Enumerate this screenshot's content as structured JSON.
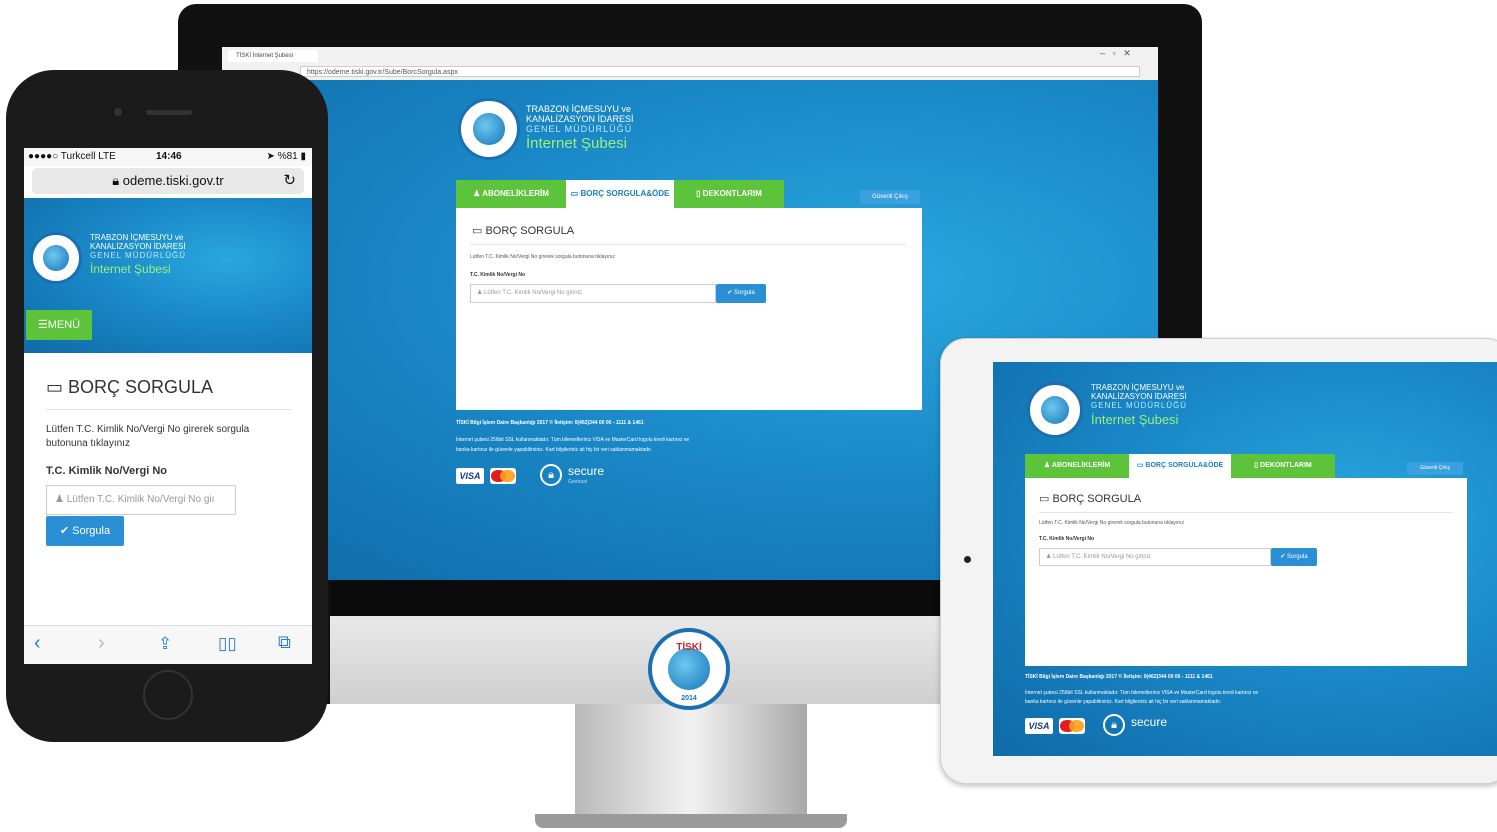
{
  "site": {
    "org_line1": "TRABZON İÇMESUYU ve",
    "org_line2": "KANALİZASYON İDARESİ",
    "org_line3": "GENEL MÜDÜRLÜĞÜ",
    "brand": "İnternet Şubesi",
    "emblem_text": "TİSKİ",
    "emblem_year": "2014"
  },
  "desktop": {
    "browser_tab": "TİSKİ İnternet Şubesi",
    "url": "https://odeme.tiski.gov.tr/Sube/BorcSorgula.aspx",
    "tabs": [
      "ABONELİKLERİM",
      "BORÇ SORGULA&ÖDE",
      "DEKONTLARIM"
    ],
    "logout": "Güvenli Çıkış",
    "panel_title": "BORÇ SORGULA",
    "instruction": "Lütfen T.C. Kimlik No/Vergi No girerek sorgula butonuna tıklayınız",
    "field_label": "T.C. Kimlik No/Vergi No",
    "field_placeholder": "Lütfen T.C. Kimlik No/Vergi No giriniz",
    "button": "Sorgula",
    "footer_line1": "TİSKİ Bilgi İşlem Daire Başkanlığı 2017 © İletişim: 0(462)344 00 00 - 1111 & 1461",
    "footer_line2": "İnternet şubesi 256bit SSL kullanmaktadır. Tüm bilemelleriniz VISA ve MasterCard logolu kredi kartınız ve",
    "footer_line3": "banka kartınız ile güvenle yapabilirsiniz. Kart bilgileriniz ait hiç bir veri saklanmamaktadır.",
    "visa": "VISA",
    "secure": "secure",
    "secure_sub": "Geotrust"
  },
  "phone": {
    "carrier": "●●●●○ Turkcell  LTE",
    "time": "14:46",
    "battery": "%81",
    "url": "odeme.tiski.gov.tr",
    "menu": "MENÜ",
    "panel_title": "BORÇ SORGULA",
    "instruction": "Lütfen T.C. Kimlik No/Vergi No girerek sorgula butonuna tıklayınız",
    "field_label": "T.C. Kimlik No/Vergi No",
    "field_placeholder": "Lütfen T.C. Kimlik No/Vergi No giı",
    "button": "Sorgula"
  },
  "tablet": {
    "tabs": [
      "ABONELİKLERİM",
      "BORÇ SORGULA&ÖDE",
      "DEKONTLARIM"
    ],
    "logout": "Güvenli Çıkış",
    "panel_title": "BORÇ SORGULA",
    "instruction": "Lütfen T.C. Kimlik No/Vergi No girerek sorgula butonuna tıklayınız",
    "field_label": "T.C. Kimlik No/Vergi No",
    "field_placeholder": "Lütfen T.C. Kimlik No/Vergi No giriniz",
    "button": "Sorgula",
    "footer_line1": "TİSKİ Bilgi İşlem Daire Başkanlığı 2017 © İletişim: 0(462)344 00 00 - 1111 & 1461",
    "footer_line2": "İnternet şubesi 256bit SSL kullanmaktadır. Tüm bilemelleriniz VISA ve MasterCard logolu kredi kartınız ve",
    "footer_line3": "banka kartınız ile güvenle yapabilirsiniz. Kart bilgileriniz ait hiç bir veri saklanmamaktadır.",
    "visa": "VISA",
    "secure": "secure"
  },
  "monitor_emblem": {
    "text": "TİSKİ",
    "year": "2014"
  },
  "colors": {
    "primary_blue": "#1a89c8",
    "green": "#5cc33a",
    "button_blue": "#2a8fd4"
  }
}
